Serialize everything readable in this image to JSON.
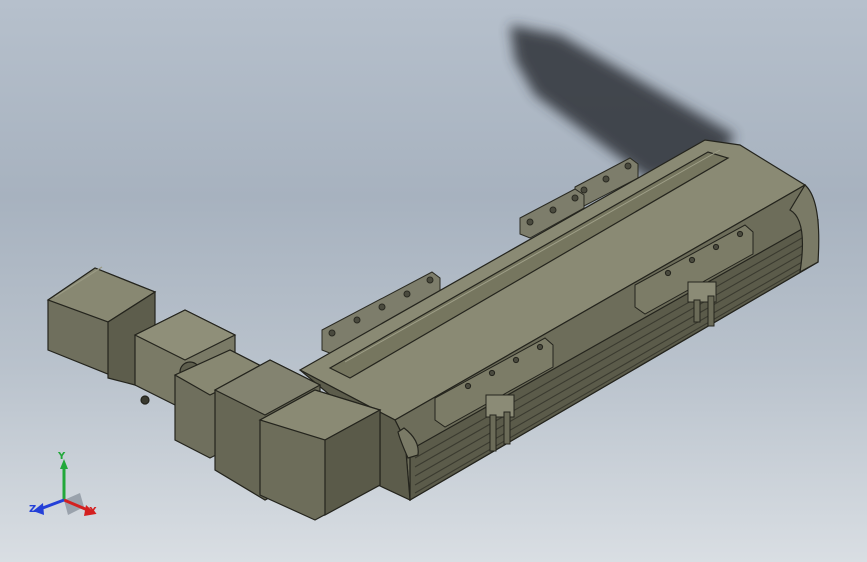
{
  "view": {
    "background_top": "#b6c0cc",
    "background_bottom": "#d9dee3",
    "model_color": "#6b6b5b",
    "shadow_color": "#2f3338"
  },
  "triad": {
    "x_label": "X",
    "y_label": "Y",
    "z_label": "Z",
    "x_color": "#d42020",
    "y_color": "#22a83a",
    "z_color": "#2440d8"
  }
}
